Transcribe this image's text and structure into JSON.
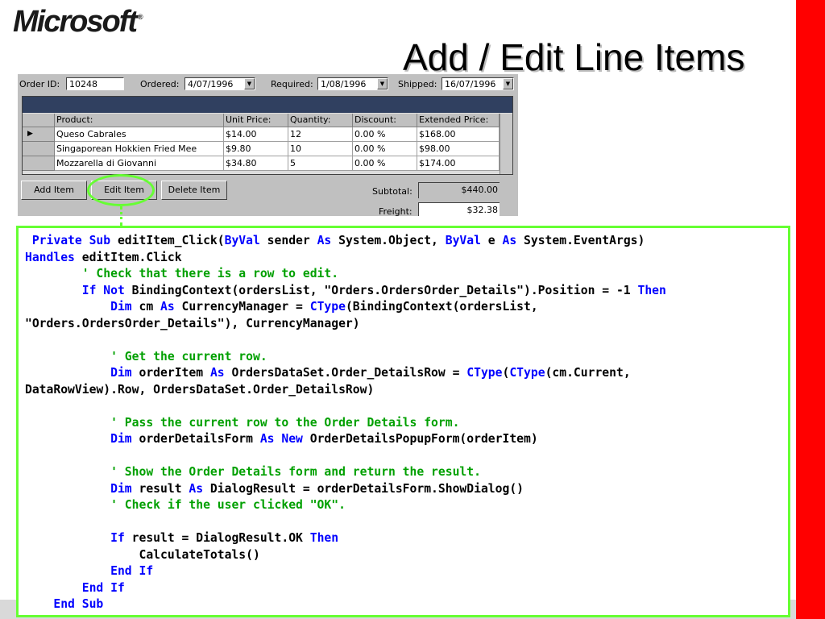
{
  "slide": {
    "logo": "Microsoft",
    "logo_mark": "®",
    "title": "Add / Edit Line Items"
  },
  "form": {
    "order_id_label": "Order ID:",
    "order_id": "10248",
    "ordered_label": "Ordered:",
    "ordered": "4/07/1996",
    "required_label": "Required:",
    "required": "1/08/1996",
    "shipped_label": "Shipped:",
    "shipped": "16/07/1996",
    "columns": [
      "Product:",
      "Unit Price:",
      "Quantity:",
      "Discount:",
      "Extended Price:"
    ],
    "rows": [
      {
        "product": "Queso Cabrales",
        "unit_price": "$14.00",
        "quantity": "12",
        "discount": "0.00 %",
        "extended": "$168.00",
        "current": true
      },
      {
        "product": "Singaporean Hokkien Fried Mee",
        "unit_price": "$9.80",
        "quantity": "10",
        "discount": "0.00 %",
        "extended": "$98.00",
        "current": false
      },
      {
        "product": "Mozzarella di Giovanni",
        "unit_price": "$34.80",
        "quantity": "5",
        "discount": "0.00 %",
        "extended": "$174.00",
        "current": false
      }
    ],
    "add_item_label": "Add Item",
    "edit_item_label": "Edit Item",
    "delete_item_label": "Delete Item",
    "subtotal_label": "Subtotal:",
    "subtotal": "$440.00",
    "freight_label": "Freight:",
    "freight": "$32.38",
    "row_indicator_icon": "row-pointer-icon",
    "dropdown_icon": "dropdown-arrow-icon"
  },
  "code": {
    "lines": [
      [
        {
          "t": " "
        },
        {
          "t": "Private Sub",
          "c": "kw"
        },
        {
          "t": " editItem_Click("
        },
        {
          "t": "ByVal",
          "c": "kw"
        },
        {
          "t": " sender "
        },
        {
          "t": "As",
          "c": "kw"
        },
        {
          "t": " System.Object, "
        },
        {
          "t": "ByVal",
          "c": "kw"
        },
        {
          "t": " e "
        },
        {
          "t": "As",
          "c": "kw"
        },
        {
          "t": " System.EventArgs)"
        }
      ],
      [
        {
          "t": "Handles",
          "c": "kw"
        },
        {
          "t": " editItem.Click"
        }
      ],
      [
        {
          "t": "        "
        },
        {
          "t": "' Check that there is a row to edit.",
          "c": "cm"
        }
      ],
      [
        {
          "t": "        "
        },
        {
          "t": "If Not",
          "c": "kw"
        },
        {
          "t": " BindingContext(ordersList, \"Orders.OrdersOrder_Details\").Position = -1 "
        },
        {
          "t": "Then",
          "c": "kw"
        }
      ],
      [
        {
          "t": "            "
        },
        {
          "t": "Dim",
          "c": "kw"
        },
        {
          "t": " cm "
        },
        {
          "t": "As",
          "c": "kw"
        },
        {
          "t": " CurrencyManager = "
        },
        {
          "t": "CType",
          "c": "kw"
        },
        {
          "t": "(BindingContext(ordersList,"
        }
      ],
      [
        {
          "t": "\"Orders.OrdersOrder_Details\"), CurrencyManager)"
        }
      ],
      [
        {
          "t": ""
        }
      ],
      [
        {
          "t": "            "
        },
        {
          "t": "' Get the current row.",
          "c": "cm"
        }
      ],
      [
        {
          "t": "            "
        },
        {
          "t": "Dim",
          "c": "kw"
        },
        {
          "t": " orderItem "
        },
        {
          "t": "As",
          "c": "kw"
        },
        {
          "t": " OrdersDataSet.Order_DetailsRow = "
        },
        {
          "t": "CType",
          "c": "kw"
        },
        {
          "t": "("
        },
        {
          "t": "CType",
          "c": "kw"
        },
        {
          "t": "(cm.Current,"
        }
      ],
      [
        {
          "t": "DataRowView).Row, OrdersDataSet.Order_DetailsRow)"
        }
      ],
      [
        {
          "t": ""
        }
      ],
      [
        {
          "t": "            "
        },
        {
          "t": "' Pass the current row to the Order Details form.",
          "c": "cm"
        }
      ],
      [
        {
          "t": "            "
        },
        {
          "t": "Dim",
          "c": "kw"
        },
        {
          "t": " orderDetailsForm "
        },
        {
          "t": "As New",
          "c": "kw"
        },
        {
          "t": " OrderDetailsPopupForm(orderItem)"
        }
      ],
      [
        {
          "t": ""
        }
      ],
      [
        {
          "t": "            "
        },
        {
          "t": "' Show the Order Details form and return the result.",
          "c": "cm"
        }
      ],
      [
        {
          "t": "            "
        },
        {
          "t": "Dim",
          "c": "kw"
        },
        {
          "t": " result "
        },
        {
          "t": "As",
          "c": "kw"
        },
        {
          "t": " DialogResult = orderDetailsForm.ShowDialog()"
        }
      ],
      [
        {
          "t": "            "
        },
        {
          "t": "' Check if the user clicked \"OK\".",
          "c": "cm"
        }
      ],
      [
        {
          "t": ""
        }
      ],
      [
        {
          "t": "            "
        },
        {
          "t": "If",
          "c": "kw"
        },
        {
          "t": " result = DialogResult.OK "
        },
        {
          "t": "Then",
          "c": "kw"
        }
      ],
      [
        {
          "t": "                CalculateTotals()"
        }
      ],
      [
        {
          "t": "            "
        },
        {
          "t": "End If",
          "c": "kw"
        }
      ],
      [
        {
          "t": "        "
        },
        {
          "t": "End If",
          "c": "kw"
        }
      ],
      [
        {
          "t": "    "
        },
        {
          "t": "End Sub",
          "c": "kw"
        }
      ]
    ]
  },
  "colors": {
    "accent_red": "#ff0000",
    "highlight_green": "#66ff33",
    "keyword_blue": "#0000ff",
    "comment_green": "#00a000"
  }
}
